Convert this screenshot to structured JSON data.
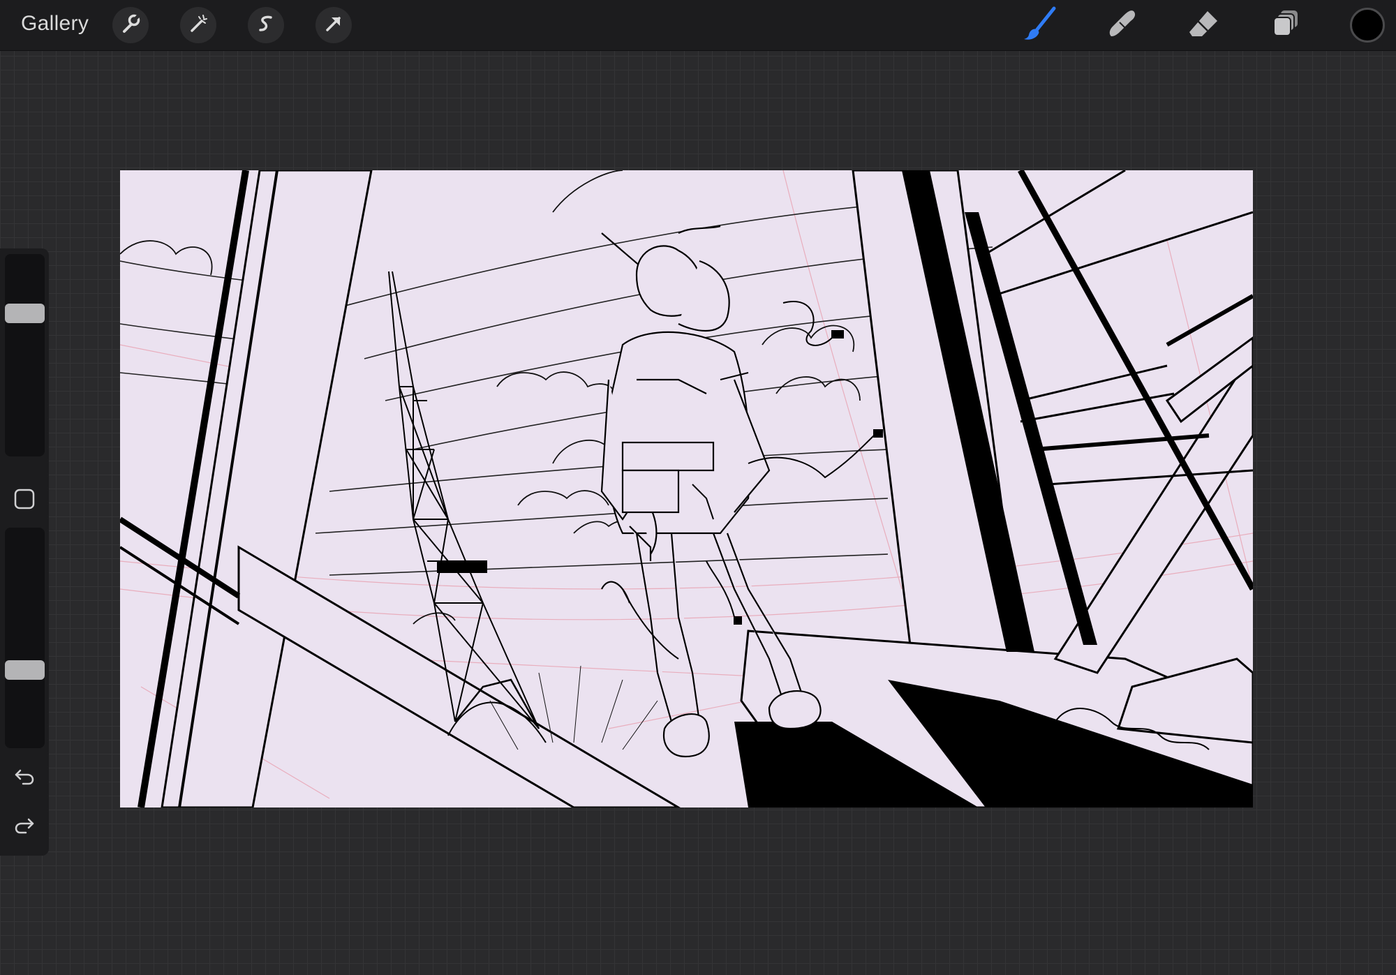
{
  "app": {
    "gallery_label": "Gallery"
  },
  "toolbar_left": [
    {
      "name": "actions",
      "icon": "wrench-icon"
    },
    {
      "name": "adjustments",
      "icon": "magic-wand-icon"
    },
    {
      "name": "selection",
      "icon": "selection-s-icon"
    },
    {
      "name": "transform",
      "icon": "arrow-cursor-icon"
    }
  ],
  "toolbar_right": [
    {
      "name": "brush",
      "icon": "brush-icon",
      "active": true
    },
    {
      "name": "smudge",
      "icon": "smudge-finger-icon",
      "active": false
    },
    {
      "name": "eraser",
      "icon": "eraser-icon",
      "active": false
    },
    {
      "name": "layers",
      "icon": "layers-icon",
      "active": false
    }
  ],
  "current_color": "#000000",
  "accent_color": "#2f7cf6",
  "sidebar": {
    "brush_size_level": 0.73,
    "opacity_level": 0.34,
    "modify_icon": "square-modify-icon",
    "undo_icon": "undo-icon",
    "redo_icon": "redo-icon"
  },
  "canvas": {
    "background_color": "#ebe2f0",
    "line_color": "#000000",
    "sketch_color": "#e8a0b0"
  }
}
